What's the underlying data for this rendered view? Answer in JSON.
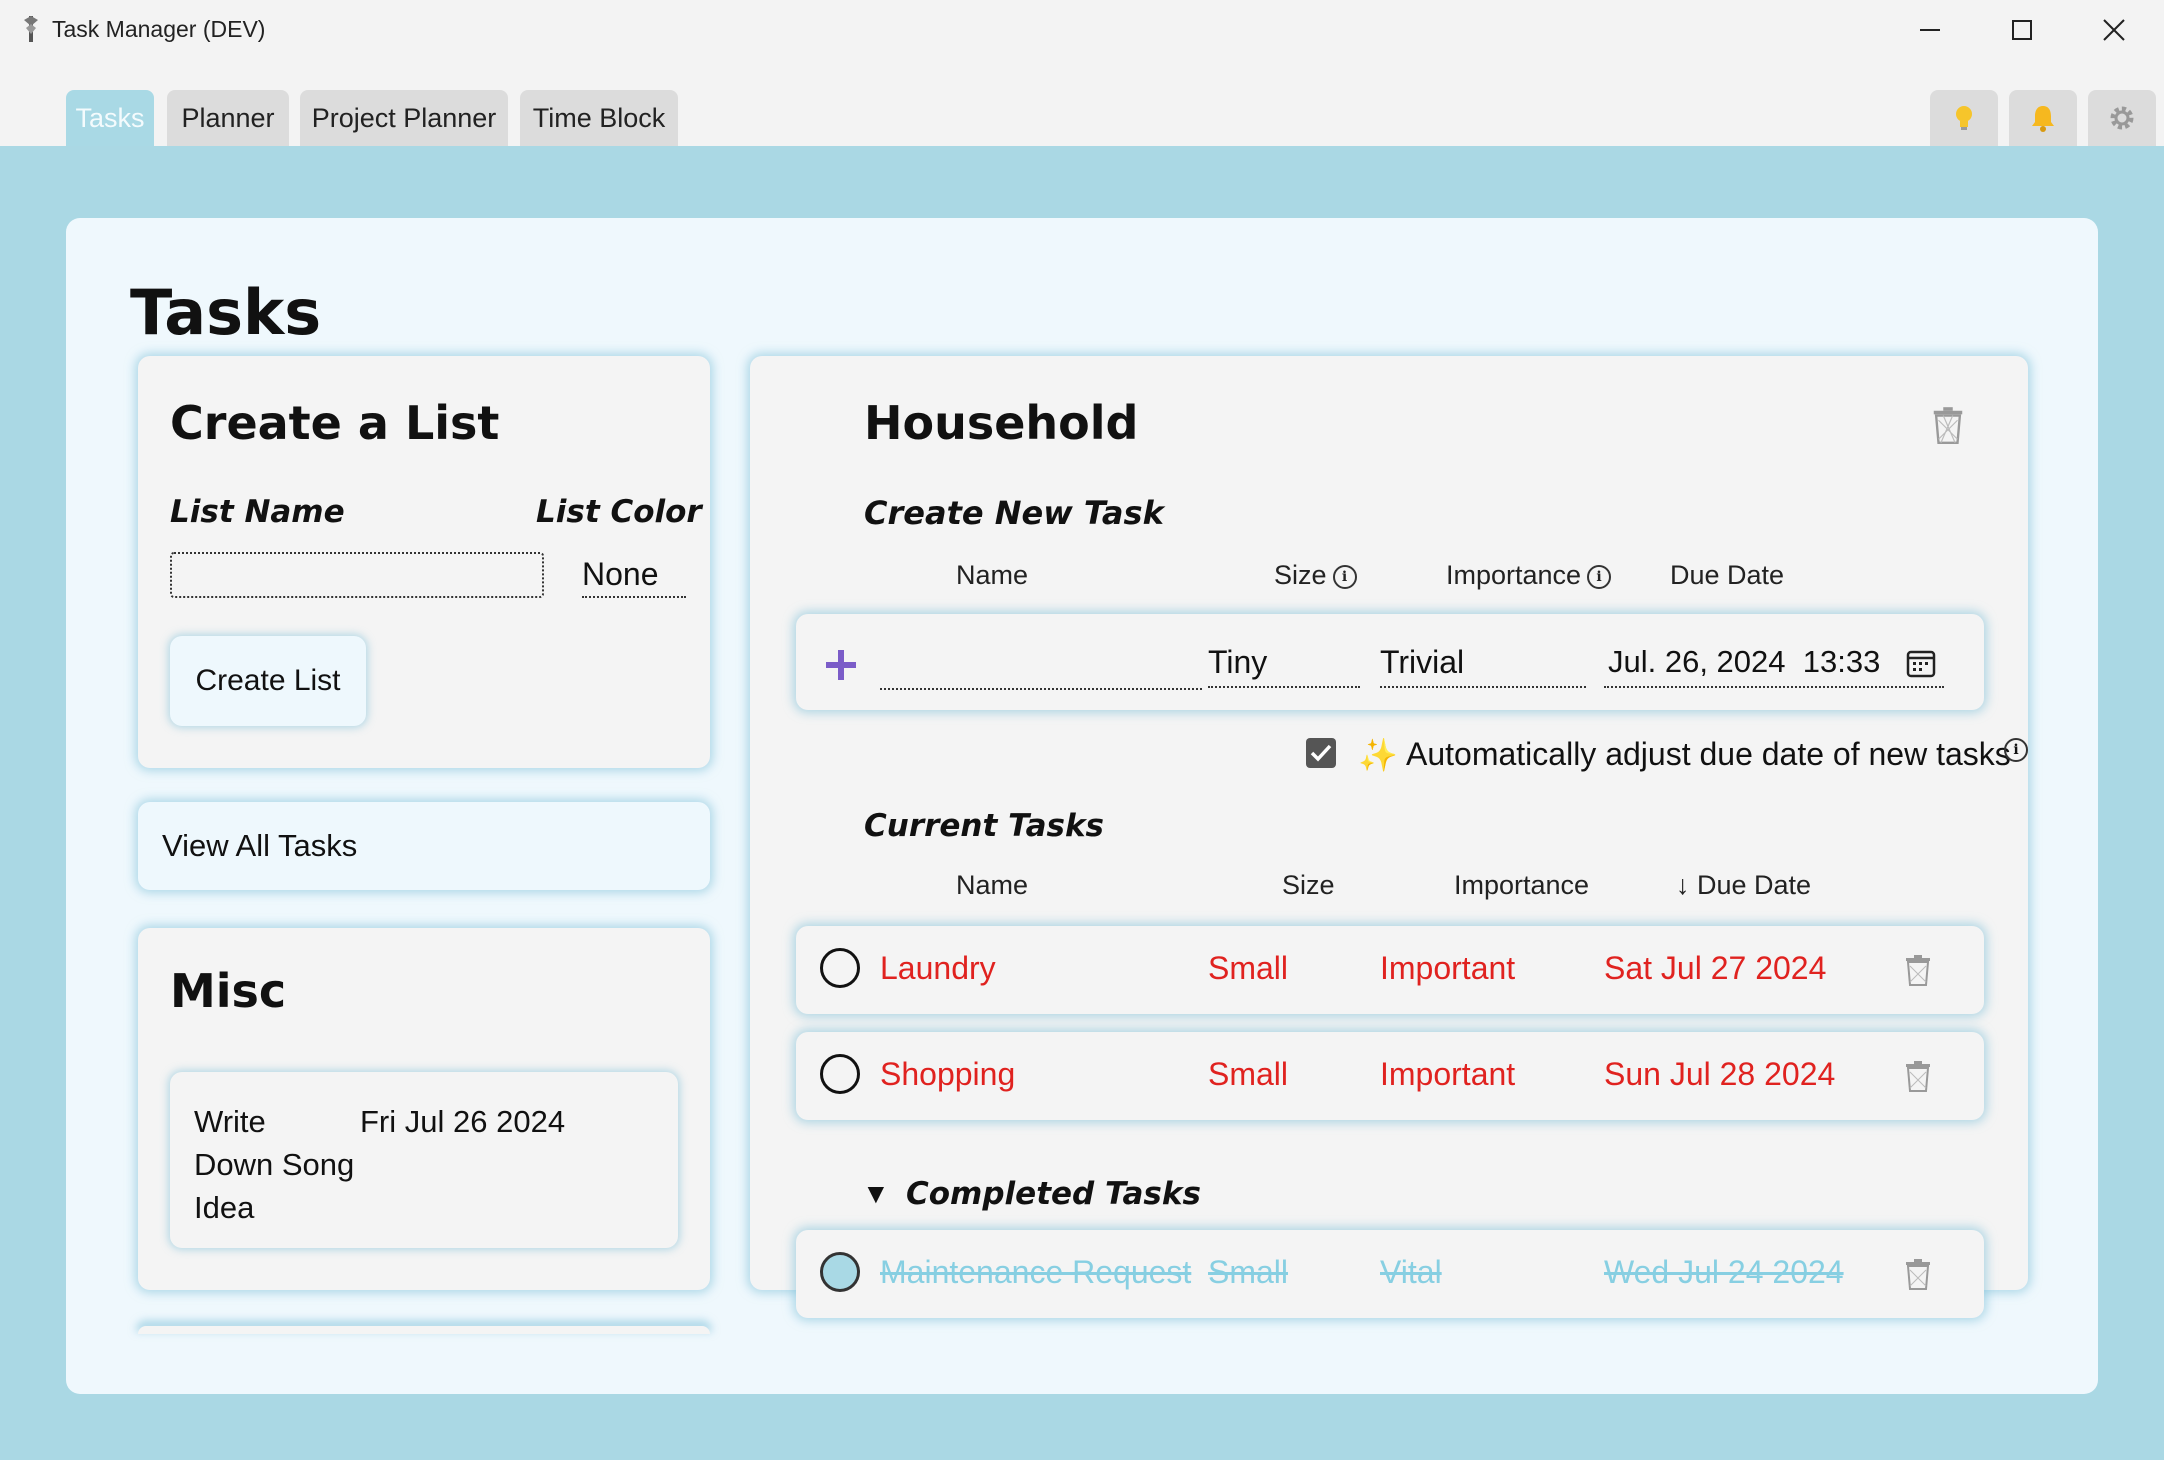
{
  "window": {
    "title": "Task Manager (DEV)"
  },
  "tabs": [
    {
      "label": "Tasks",
      "active": true
    },
    {
      "label": "Planner",
      "active": false
    },
    {
      "label": "Project Planner",
      "active": false
    },
    {
      "label": "Time Block",
      "active": false
    }
  ],
  "toolbar_icons": [
    "lightbulb-icon",
    "bell-icon",
    "gear-icon"
  ],
  "page": {
    "title": "Tasks"
  },
  "create_list": {
    "title": "Create a List",
    "name_label": "List Name",
    "color_label": "List Color",
    "name_value": "",
    "color_value": "None",
    "button_label": "Create List"
  },
  "view_all": {
    "label": "View All Tasks"
  },
  "misc": {
    "title": "Misc",
    "task_name_lines": [
      "Write",
      "Down Song",
      "Idea"
    ],
    "task_date": "Fri Jul 26 2024"
  },
  "household": {
    "title": "Household",
    "create_label": "Create New Task",
    "new_task_columns": {
      "name": "Name",
      "size": "Size",
      "importance": "Importance",
      "due": "Due Date"
    },
    "new_task": {
      "name": "",
      "size": "Tiny",
      "importance": "Trivial",
      "due": "Jul. 26, 2024  13:33"
    },
    "auto_adjust": {
      "checked": true,
      "emoji": "✨",
      "label": "Automatically adjust due date of new tasks"
    },
    "current_label": "Current Tasks",
    "current_columns": {
      "name": "Name",
      "size": "Size",
      "importance": "Importance",
      "due": "↓ Due Date"
    },
    "current_tasks": [
      {
        "name": "Laundry",
        "size": "Small",
        "importance": "Important",
        "due": "Sat Jul 27 2024"
      },
      {
        "name": "Shopping",
        "size": "Small",
        "importance": "Important",
        "due": "Sun Jul 28 2024"
      }
    ],
    "completed_toggle": "▼",
    "completed_label": "Completed Tasks",
    "completed_tasks": [
      {
        "name": "Maintenance Request",
        "size": "Small",
        "importance": "Vital",
        "due": "Wed Jul 24 2024"
      }
    ]
  },
  "colors": {
    "accent": "#aad8e4",
    "active_tab": "#a9d9e5",
    "overdue_text": "#e0221f",
    "completed_text": "#87cfe2",
    "add_icon": "#7b5cc8"
  }
}
